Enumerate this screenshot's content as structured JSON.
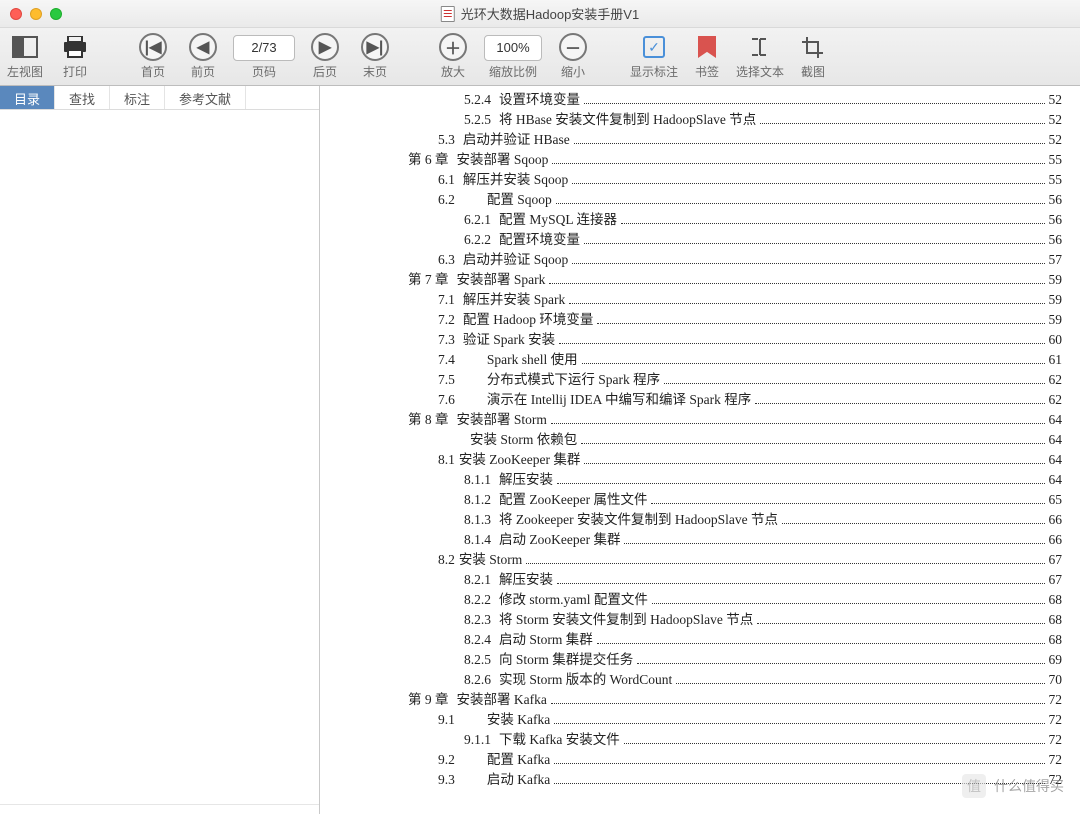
{
  "window": {
    "title": "光环大数据Hadoop安装手册V1"
  },
  "toolbar": {
    "left_view": "左视图",
    "print": "打印",
    "first": "首页",
    "prev": "前页",
    "page_input": "2/73",
    "page_label": "页码",
    "next": "后页",
    "last": "末页",
    "zoom_in": "放大",
    "zoom_value": "100%",
    "zoom_label": "缩放比例",
    "zoom_out": "缩小",
    "show_annot": "显示标注",
    "bookmark": "书签",
    "select_text": "选择文本",
    "crop": "截图"
  },
  "tabs": {
    "toc": "目录",
    "find": "查找",
    "annot": "标注",
    "refs": "参考文献"
  },
  "toc": [
    {
      "ind": "ind2",
      "num": "5.2.4",
      "title": "设置环境变量",
      "page": "52"
    },
    {
      "ind": "ind2",
      "num": "5.2.5",
      "title": "将 HBase 安装文件复制到 HadoopSlave 节点",
      "page": "52"
    },
    {
      "ind": "ind1",
      "num": "5.3",
      "title": "启动并验证 HBase",
      "page": "52"
    },
    {
      "ind": "ind0",
      "num": "第 6 章",
      "title": "安装部署 Sqoop",
      "page": "55"
    },
    {
      "ind": "ind1",
      "num": "6.1",
      "title": "解压并安装 Sqoop",
      "page": "55"
    },
    {
      "ind": "ind1",
      "num": "6.2",
      "title": "配置 Sqoop",
      "page": "56",
      "pad": true
    },
    {
      "ind": "ind2",
      "num": "6.2.1",
      "title": "配置 MySQL 连接器",
      "page": "56"
    },
    {
      "ind": "ind2",
      "num": "6.2.2",
      "title": "配置环境变量",
      "page": "56"
    },
    {
      "ind": "ind1",
      "num": "6.3",
      "title": "启动并验证 Sqoop",
      "page": "57"
    },
    {
      "ind": "ind0",
      "num": "第 7 章",
      "title": "安装部署 Spark",
      "page": "59"
    },
    {
      "ind": "ind1",
      "num": "7.1",
      "title": "解压并安装 Spark",
      "page": "59"
    },
    {
      "ind": "ind1",
      "num": "7.2",
      "title": "配置 Hadoop 环境变量",
      "page": "59"
    },
    {
      "ind": "ind1",
      "num": "7.3",
      "title": "验证 Spark 安装",
      "page": "60"
    },
    {
      "ind": "ind1",
      "num": "7.4",
      "title": "Spark shell 使用",
      "page": "61",
      "pad": true
    },
    {
      "ind": "ind1",
      "num": "7.5",
      "title": "分布式模式下运行 Spark  程序",
      "page": "62",
      "pad": true
    },
    {
      "ind": "ind1",
      "num": "7.6",
      "title": "演示在 Intellij IDEA 中编写和编译 Spark 程序",
      "page": "62",
      "pad": true
    },
    {
      "ind": "ind0",
      "num": "第 8 章",
      "title": "安装部署 Storm",
      "page": "64",
      "tight": true
    },
    {
      "ind": "ind1",
      "num": "",
      "title": "安装 Storm 依赖包",
      "page": "64",
      "pad": true
    },
    {
      "ind": "ind1",
      "num": "8.1",
      "title": "安装 ZooKeeper 集群",
      "page": "64",
      "tight": true
    },
    {
      "ind": "ind2",
      "num": "8.1.1",
      "title": "解压安装",
      "page": "64"
    },
    {
      "ind": "ind2",
      "num": "8.1.2",
      "title": "配置 ZooKeeper 属性文件",
      "page": "65"
    },
    {
      "ind": "ind2",
      "num": "8.1.3",
      "title": "将 Zookeeper 安装文件复制到 HadoopSlave 节点",
      "page": "66"
    },
    {
      "ind": "ind2",
      "num": "8.1.4",
      "title": "启动 ZooKeeper 集群",
      "page": "66"
    },
    {
      "ind": "ind1",
      "num": "8.2",
      "title": "安装 Storm",
      "page": "67",
      "tight": true
    },
    {
      "ind": "ind2",
      "num": "8.2.1",
      "title": "解压安装",
      "page": "67"
    },
    {
      "ind": "ind2",
      "num": "8.2.2",
      "title": "修改 storm.yaml 配置文件",
      "page": "68"
    },
    {
      "ind": "ind2",
      "num": "8.2.3",
      "title": "将 Storm 安装文件复制到 HadoopSlave 节点",
      "page": "68"
    },
    {
      "ind": "ind2",
      "num": "8.2.4",
      "title": "启动 Storm 集群",
      "page": "68"
    },
    {
      "ind": "ind2",
      "num": "8.2.5",
      "title": "向 Storm 集群提交任务",
      "page": "69"
    },
    {
      "ind": "ind2",
      "num": "8.2.6",
      "title": "实现 Storm 版本的 WordCount",
      "page": "70"
    },
    {
      "ind": "ind0",
      "num": "第 9 章",
      "title": "安装部署 Kafka",
      "page": "72",
      "tight": true
    },
    {
      "ind": "ind1",
      "num": "9.1",
      "title": "安装 Kafka",
      "page": "72",
      "pad": true
    },
    {
      "ind": "ind2",
      "num": "9.1.1",
      "title": "下载 Kafka 安装文件",
      "page": "72"
    },
    {
      "ind": "ind1",
      "num": "9.2",
      "title": "配置 Kafka",
      "page": "72",
      "pad": true
    },
    {
      "ind": "ind1",
      "num": "9.3",
      "title": "启动 Kafka",
      "page": "72",
      "pad": true
    }
  ],
  "watermark": {
    "text": "什么值得买",
    "short": "值"
  }
}
